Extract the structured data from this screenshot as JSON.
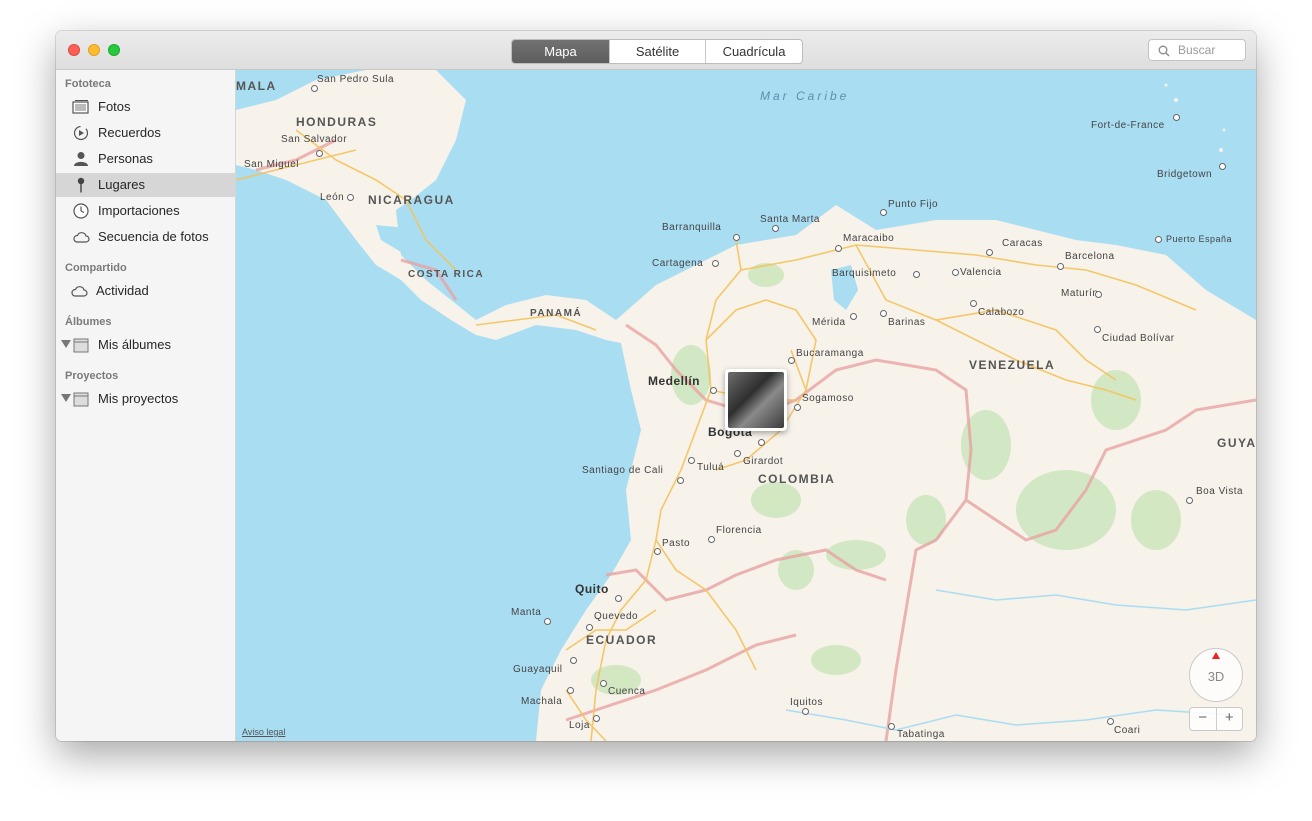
{
  "toolbar": {
    "tabs": [
      {
        "label": "Mapa",
        "active": true
      },
      {
        "label": "Satélite",
        "active": false
      },
      {
        "label": "Cuadrícula",
        "active": false
      }
    ],
    "search_placeholder": "Buscar"
  },
  "sidebar": {
    "fototeca": {
      "title": "Fototeca",
      "items": [
        {
          "label": "Fotos",
          "icon": "photos-icon"
        },
        {
          "label": "Recuerdos",
          "icon": "memories-icon"
        },
        {
          "label": "Personas",
          "icon": "person-icon"
        },
        {
          "label": "Lugares",
          "icon": "pin-icon",
          "selected": true
        },
        {
          "label": "Importaciones",
          "icon": "clock-icon"
        },
        {
          "label": "Secuencia de fotos",
          "icon": "cloud-icon"
        }
      ]
    },
    "compartido": {
      "title": "Compartido",
      "items": [
        {
          "label": "Actividad",
          "icon": "cloud-icon"
        }
      ]
    },
    "albumes": {
      "title": "Álbumes",
      "items": [
        {
          "label": "Mis álbumes",
          "icon": "folder-icon"
        }
      ]
    },
    "proyectos": {
      "title": "Proyectos",
      "items": [
        {
          "label": "Mis proyectos",
          "icon": "folder-icon"
        }
      ]
    }
  },
  "map": {
    "sea_label": "Mar Caribe",
    "countries": [
      "MALA",
      "HONDURAS",
      "NICARAGUA",
      "COSTA RICA",
      "PANAMÁ",
      "VENEZUELA",
      "COLOMBIA",
      "ECUADOR",
      "GUYA"
    ],
    "major_cities": [
      "Medellín",
      "Bogotá",
      "Quito"
    ],
    "cities": [
      "San Pedro Sula",
      "San Salvador",
      "San Miguel",
      "León",
      "Fort-de-France",
      "Bridgetown",
      "Punto Fijo",
      "Barranquilla",
      "Santa Marta",
      "Cartagena",
      "Maracaibo",
      "Caracas",
      "Puerto España",
      "Barquisimeto",
      "Valencia",
      "Barcelona",
      "Maturín",
      "Mérida",
      "Barinas",
      "Calabozo",
      "Ciudad Bolívar",
      "Bucaramanga",
      "Sogamoso",
      "Santiago de Cali",
      "Tuluá",
      "Girardot",
      "Boa Vista",
      "Florencia",
      "Pasto",
      "Manta",
      "Quevedo",
      "Guayaquil",
      "Cuenca",
      "Machala",
      "Loja",
      "Iquitos",
      "Tabatinga",
      "Coari"
    ],
    "legal_link": "Aviso legal",
    "compass_label": "3D",
    "zoom_out": "−",
    "zoom_in": "+",
    "colors": {
      "water": "#a9ddf2",
      "land": "#f7f2ea",
      "roads": "#f4c35a",
      "border": "#e8a3a3",
      "vegetation": "#cfe6bf"
    }
  }
}
